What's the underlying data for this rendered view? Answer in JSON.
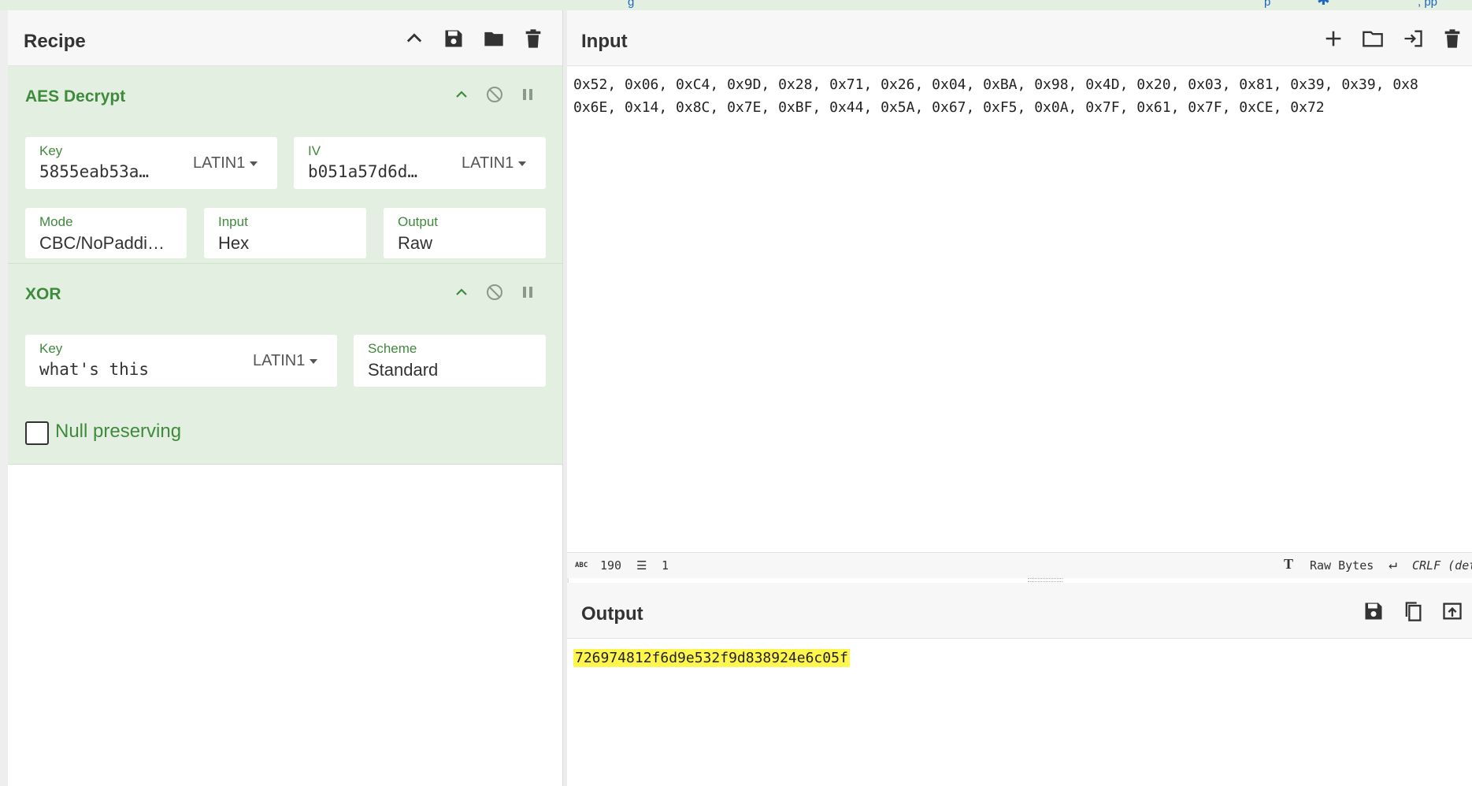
{
  "top_bar": {
    "fragments": [
      "g",
      "p",
      ", pp"
    ]
  },
  "recipe": {
    "title": "Recipe",
    "icons": [
      "chevron-up-icon",
      "save-icon",
      "folder-icon",
      "trash-icon"
    ]
  },
  "operations": {
    "aes": {
      "title": "AES Decrypt",
      "key": {
        "label": "Key",
        "value": "5855eab53a…",
        "encoding": "LATIN1"
      },
      "iv": {
        "label": "IV",
        "value": "b051a57d6d…",
        "encoding": "LATIN1"
      },
      "mode": {
        "label": "Mode",
        "value": "CBC/NoPaddi…"
      },
      "input": {
        "label": "Input",
        "value": "Hex"
      },
      "output": {
        "label": "Output",
        "value": "Raw"
      }
    },
    "xor": {
      "title": "XOR",
      "key": {
        "label": "Key",
        "value": "what's this",
        "encoding": "LATIN1"
      },
      "scheme": {
        "label": "Scheme",
        "value": "Standard"
      },
      "null_preserving": {
        "label": "Null preserving",
        "checked": false
      }
    }
  },
  "input": {
    "title": "Input",
    "lines": [
      "0x52, 0x06, 0xC4, 0x9D, 0x28, 0x71, 0x26, 0x04, 0xBA, 0x98, 0x4D, 0x20, 0x03, 0x81, 0x39, 0x39, 0x8",
      "0x6E, 0x14, 0x8C, 0x7E, 0xBF, 0x44, 0x5A, 0x67, 0xF5, 0x0A, 0x7F, 0x61, 0x7F, 0xCE, 0x72"
    ],
    "status": {
      "abc_label": "ABC",
      "length": "190",
      "lines": "1",
      "format": "Raw Bytes",
      "eol": "CRLF (det"
    }
  },
  "output": {
    "title": "Output",
    "value": "726974812f6d9e532f9d838924e6c05f"
  },
  "colors": {
    "accent_green": "#3f8a3d",
    "op_bg": "#e3f0e1",
    "highlight": "#fff64d"
  }
}
